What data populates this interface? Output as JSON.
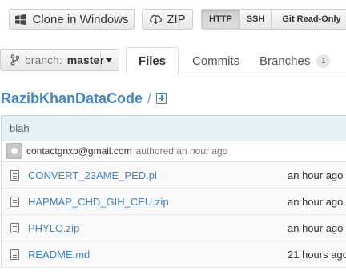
{
  "toolbar": {
    "clone_label": "Clone in Windows",
    "zip_label": "ZIP",
    "protocols": [
      {
        "label": "HTTP",
        "selected": true
      },
      {
        "label": "SSH",
        "selected": false
      },
      {
        "label": "Git Read-Only",
        "selected": false
      }
    ]
  },
  "branch": {
    "prefix": "branch:",
    "name": "master"
  },
  "tabs": [
    {
      "label": "Files",
      "active": true
    },
    {
      "label": "Commits",
      "active": false
    },
    {
      "label": "Branches",
      "active": false,
      "count": "1"
    }
  ],
  "breadcrumb": {
    "repo": "RazibKhanDataCode",
    "separator": "/"
  },
  "commit": {
    "message": "blah",
    "author": "contactgnxp@gmail.com",
    "authored_text": "authored an hour ago"
  },
  "files": [
    {
      "name": "CONVERT_23AME_PED.pl",
      "age": "an hour ago"
    },
    {
      "name": "HAPMAP_CHD_GIH_CEU.zip",
      "age": "an hour ago"
    },
    {
      "name": "PHYLO.zip",
      "age": "an hour ago"
    },
    {
      "name": "README.md",
      "age": "21 hours ago"
    }
  ],
  "colors": {
    "link": "#4183c4",
    "commit_bar_bg": "#e6f1f6"
  }
}
